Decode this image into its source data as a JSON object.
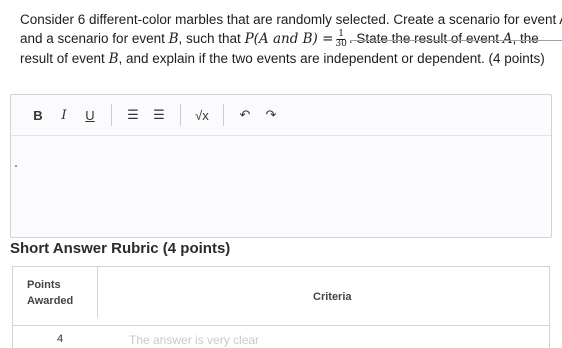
{
  "question": {
    "line1": "Consider 6 different-color marbles that are randomly selected. Create a scenario for event A",
    "line2_a": "and a scenario for event ",
    "line2_b": "B",
    "line2_c": ", such that ",
    "line2_prob": "P(A and B) =",
    "frac_num": "1",
    "frac_den": "30",
    "line2_d": ". State the result of event ",
    "line2_e": "A",
    "line2_f": ", the",
    "line3_a": "result of event ",
    "line3_b": "B",
    "line3_c": ", and explain if the two events are independent or dependent. (4 points)"
  },
  "toolbar": {
    "bold": "B",
    "italic": "I",
    "underline": "U",
    "list1": "☰",
    "list2": "☰",
    "sqrt": "√x",
    "undo": "↶",
    "redo": "↷"
  },
  "rubric": {
    "title": "Short Answer Rubric (4 points)",
    "header_points_1": "Points",
    "header_points_2": "Awarded",
    "header_criteria": "Criteria",
    "row_points": "4",
    "row_criteria": "The answer is very clear"
  }
}
